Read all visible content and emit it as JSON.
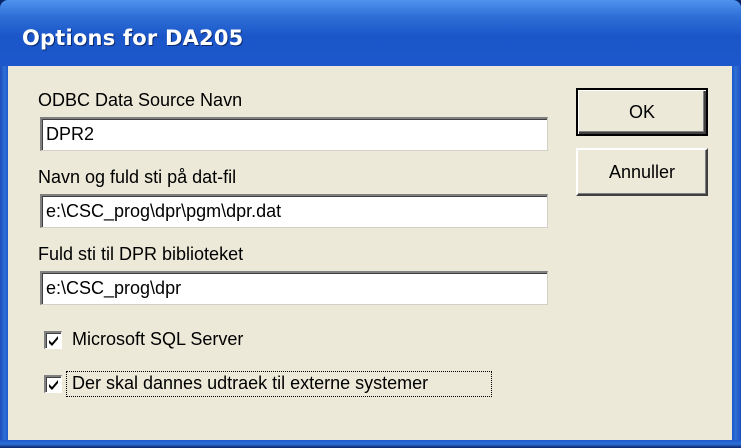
{
  "window": {
    "title": "Options for DA205"
  },
  "fields": [
    {
      "label": "ODBC Data Source Navn",
      "value": "DPR2"
    },
    {
      "label": "Navn og fuld sti på dat-fil",
      "value": "e:\\CSC_prog\\dpr\\pgm\\dpr.dat"
    },
    {
      "label": "Fuld sti til DPR biblioteket",
      "value": "e:\\CSC_prog\\dpr"
    }
  ],
  "checkboxes": [
    {
      "label": "Microsoft SQL Server",
      "checked": true
    },
    {
      "label": "Der skal dannes udtraek til externe systemer",
      "checked": true,
      "focused": true
    }
  ],
  "buttons": {
    "ok_label": "OK",
    "cancel_label": "Annuller"
  },
  "colors": {
    "titlebar": "#1c58cc",
    "dialog_face": "#ece9d8",
    "title_text": "#ffffff"
  }
}
